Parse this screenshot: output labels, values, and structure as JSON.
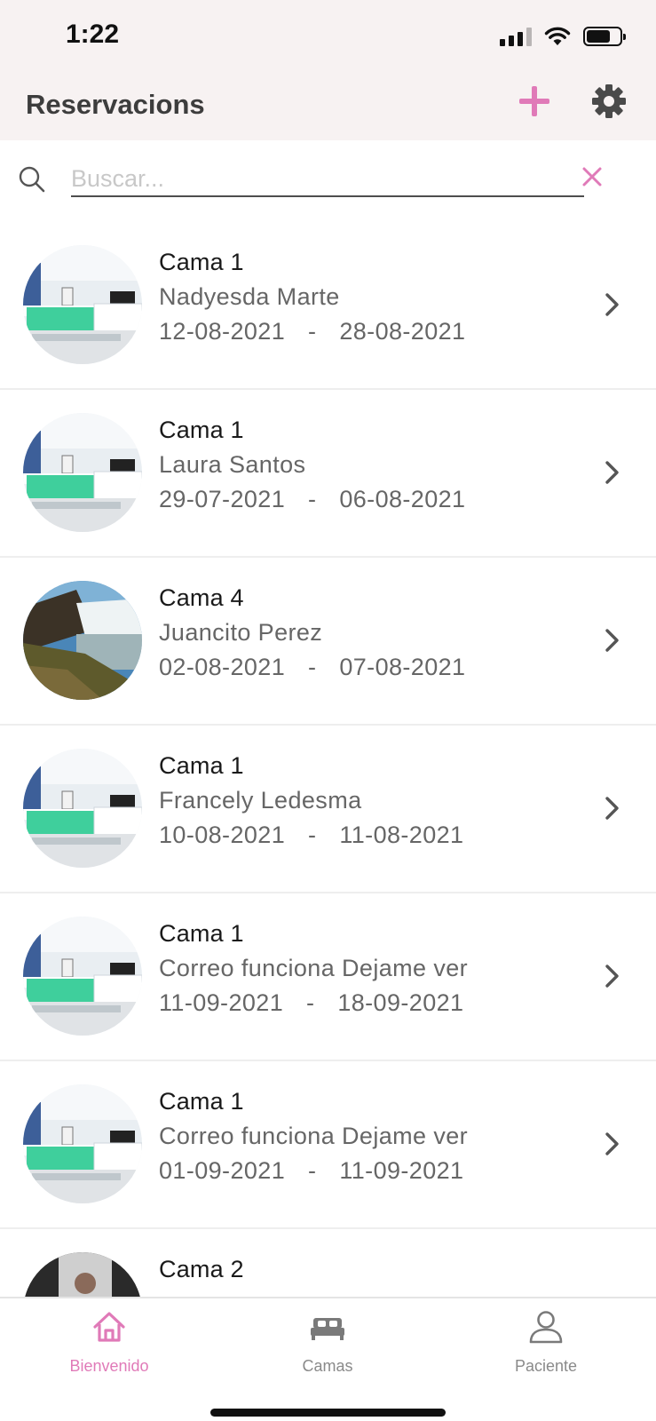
{
  "status_bar": {
    "time": "1:22"
  },
  "header": {
    "title": "Reservacions"
  },
  "search": {
    "placeholder": "Buscar...",
    "value": ""
  },
  "colors": {
    "accent": "#e07ab8",
    "header_bg": "#f7f2f2",
    "text_muted": "#666666"
  },
  "reservations": [
    {
      "bed": "Cama 1",
      "name": "Nadyesda  Marte",
      "start": "12-08-2021",
      "separator": "-",
      "end": "28-08-2021",
      "image": "hospital-room"
    },
    {
      "bed": "Cama 1",
      "name": "Laura Santos",
      "start": "29-07-2021",
      "separator": "-",
      "end": "06-08-2021",
      "image": "hospital-room"
    },
    {
      "bed": "Cama 4",
      "name": "Juancito Perez",
      "start": "02-08-2021",
      "separator": "-",
      "end": "07-08-2021",
      "image": "waterfall"
    },
    {
      "bed": "Cama 1",
      "name": "Francely Ledesma",
      "start": "10-08-2021",
      "separator": "-",
      "end": "11-08-2021",
      "image": "hospital-room"
    },
    {
      "bed": "Cama 1",
      "name": "Correo funciona Dejame ver",
      "start": "11-09-2021",
      "separator": "-",
      "end": "18-09-2021",
      "image": "hospital-room"
    },
    {
      "bed": "Cama 1",
      "name": "Correo funciona Dejame ver",
      "start": "01-09-2021",
      "separator": "-",
      "end": "11-09-2021",
      "image": "hospital-room"
    },
    {
      "bed": "Cama 2",
      "name": "",
      "start": "",
      "separator": "",
      "end": "",
      "image": "person-photo"
    }
  ],
  "tabbar": {
    "tabs": [
      {
        "label": "Bienvenido",
        "icon": "home-icon",
        "active": true
      },
      {
        "label": "Camas",
        "icon": "bed-icon",
        "active": false
      },
      {
        "label": "Paciente",
        "icon": "person-icon",
        "active": false
      }
    ]
  }
}
